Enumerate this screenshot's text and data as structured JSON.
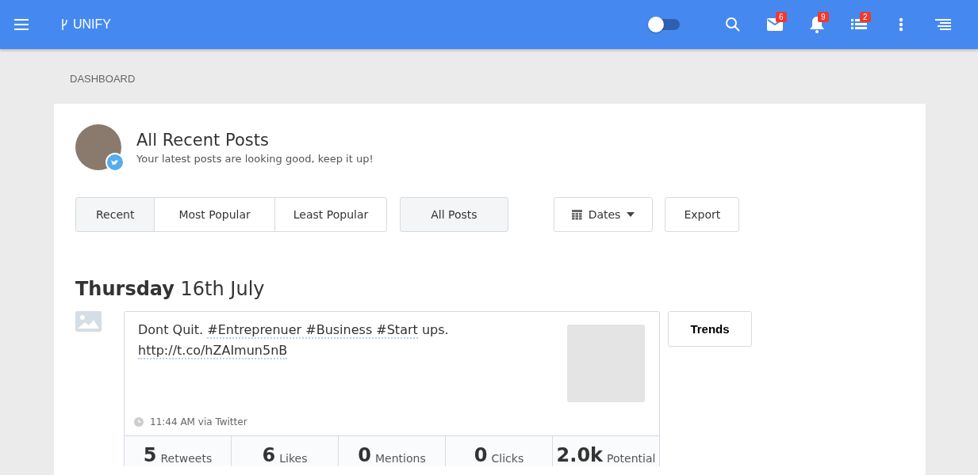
{
  "topbar": {
    "brand": "UNIFY",
    "toggle": {
      "on": false
    },
    "icons": [
      {
        "kind": "search"
      },
      {
        "kind": "mail",
        "badge": "6"
      },
      {
        "kind": "bell",
        "badge": "9"
      },
      {
        "kind": "list",
        "badge": "2"
      },
      {
        "kind": "more"
      },
      {
        "kind": "align"
      }
    ]
  },
  "breadcrumb": "DASHBOARD",
  "header": {
    "title": "All Recent Posts",
    "subtitle": "Your latest posts are looking good, keep it up!"
  },
  "sort_tabs": [
    {
      "label": "Recent",
      "selected": true
    },
    {
      "label": "Most Popular",
      "selected": false
    },
    {
      "label": "Least Popular",
      "selected": false
    }
  ],
  "filter": {
    "label": "All Posts",
    "selected": true
  },
  "dates_button": "Dates",
  "export_button": "Export",
  "date_heading": "**Thursday** 16th July",
  "post": {
    "lines": [
      {
        "segments": [
          {
            "text": "Dont Quit. ",
            "link": false
          },
          {
            "text": "#Entreprenuer #Business #Start",
            "link": true
          },
          {
            "text": " ups.",
            "link": false
          }
        ]
      },
      {
        "segments": [
          {
            "text": "http://t.co/hZAImun5nB",
            "link": true
          }
        ]
      }
    ],
    "meta": "11:44 AM via Twitter",
    "stats": [
      {
        "value": "5",
        "label": "Retweets"
      },
      {
        "value": "6",
        "label": "Likes"
      },
      {
        "value": "0",
        "label": "Mentions"
      },
      {
        "value": "0",
        "label": "Clicks"
      },
      {
        "value": "2.0k",
        "label": "Potential"
      }
    ]
  },
  "trends_button": "Trends"
}
